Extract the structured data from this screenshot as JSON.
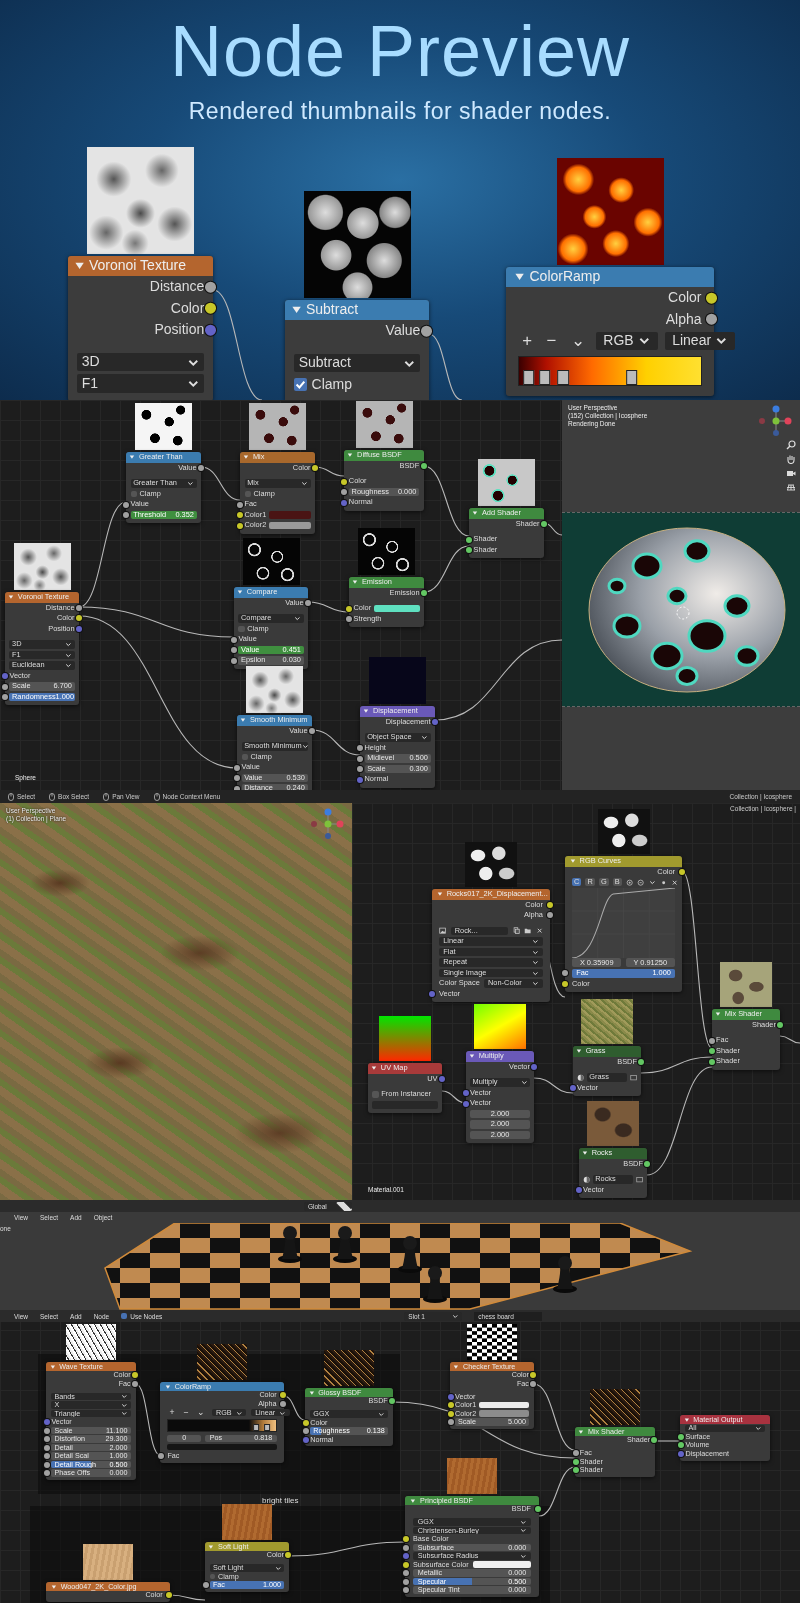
{
  "hero": {
    "title": "Node Preview",
    "subtitle": "Rendered thumbnails for shader nodes.",
    "nodes": [
      {
        "title": "Voronoi Texture",
        "color": "#b4652e",
        "preview": true,
        "rows": [
          {
            "kind": "out",
            "label": "Distance",
            "socket": {
              "color": "#a1a1a1"
            }
          },
          {
            "kind": "out",
            "label": "Color",
            "socket": {
              "color": "#c7c729"
            }
          },
          {
            "kind": "out",
            "label": "Position",
            "socket": {
              "color": "#6363c7"
            }
          },
          {
            "kind": "select",
            "label": "3D"
          },
          {
            "kind": "select",
            "label": "F1"
          }
        ]
      },
      {
        "title": "Subtract",
        "color": "#3b7cb0",
        "preview": true,
        "rows": [
          {
            "kind": "out",
            "label": "Value",
            "socket": {
              "color": "#a1a1a1"
            }
          },
          {
            "kind": "select",
            "label": "Subtract"
          },
          {
            "kind": "check",
            "label": "Clamp",
            "checked": true
          }
        ]
      },
      {
        "title": "ColorRamp",
        "color": "#3b7cb0",
        "preview": true,
        "rows": [
          {
            "kind": "out",
            "label": "Color",
            "socket": {
              "color": "#c7c729"
            }
          },
          {
            "kind": "out",
            "label": "Alpha",
            "socket": {
              "color": "#a1a1a1"
            }
          },
          {
            "kind": "ramp",
            "buttons": [
              "+",
              "−",
              "⌄"
            ],
            "mode": "RGB",
            "interpolation": "Linear"
          }
        ]
      }
    ]
  },
  "sphere_scene": {
    "node_editor": {
      "object_label": "Sphere",
      "nodes": [
        {
          "title": "Greater Than",
          "color": "#3b7cb0",
          "preview": true,
          "rows": [
            {
              "kind": "out",
              "label": "Value",
              "socket": {
                "color": "#a1a1a1"
              }
            },
            {
              "kind": "select",
              "label": "Greater Than"
            },
            {
              "kind": "check",
              "label": "Clamp",
              "checked": false
            },
            {
              "kind": "in",
              "label": "Value",
              "socket": {
                "color": "#a1a1a1"
              }
            },
            {
              "kind": "animated",
              "label": "Threshold",
              "value": "0.352",
              "socket": {
                "color": "#a1a1a1"
              }
            }
          ]
        },
        {
          "title": "Mix",
          "color": "#a8682c",
          "preview": true,
          "rows": [
            {
              "kind": "out",
              "label": "Color",
              "socket": {
                "color": "#c7c729"
              }
            },
            {
              "kind": "select",
              "label": "Mix"
            },
            {
              "kind": "check",
              "label": "Clamp",
              "checked": false
            },
            {
              "kind": "in",
              "label": "Fac",
              "socket": {
                "color": "#a1a1a1"
              }
            },
            {
              "kind": "swatch",
              "label": "Color1",
              "color": "#4a1414",
              "socket": {
                "color": "#c7c729"
              }
            },
            {
              "kind": "swatch",
              "label": "Color2",
              "color": "#9a9a9a",
              "socket": {
                "color": "#c7c729"
              }
            }
          ]
        },
        {
          "title": "Diffuse BSDF",
          "color": "#3f8a3f",
          "preview": true,
          "rows": [
            {
              "kind": "out",
              "label": "BSDF",
              "socket": {
                "color": "#63c763"
              }
            },
            {
              "kind": "in",
              "label": "Color",
              "socket": {
                "color": "#c7c729"
              }
            },
            {
              "kind": "num",
              "label": "Roughness",
              "value": "0.000",
              "socket": {
                "color": "#a1a1a1"
              }
            },
            {
              "kind": "in",
              "label": "Normal",
              "socket": {
                "color": "#6363c7"
              }
            }
          ]
        },
        {
          "title": "Add Shader",
          "color": "#3f8a3f",
          "preview": true,
          "rows": [
            {
              "kind": "out",
              "label": "Shader",
              "socket": {
                "color": "#63c763"
              }
            },
            {
              "kind": "in",
              "label": "Shader",
              "socket": {
                "color": "#63c763"
              }
            },
            {
              "kind": "in",
              "label": "Shader",
              "socket": {
                "color": "#63c763"
              }
            }
          ]
        },
        {
          "title": "Voronoi Texture",
          "color": "#b4652e",
          "preview": true,
          "rows": [
            {
              "kind": "out",
              "label": "Distance",
              "socket": {
                "color": "#a1a1a1"
              }
            },
            {
              "kind": "out",
              "label": "Color",
              "socket": {
                "color": "#c7c729"
              }
            },
            {
              "kind": "out",
              "label": "Position",
              "socket": {
                "color": "#6363c7"
              }
            },
            {
              "kind": "select",
              "label": "3D"
            },
            {
              "kind": "select",
              "label": "F1"
            },
            {
              "kind": "select",
              "label": "Euclidean"
            },
            {
              "kind": "in",
              "label": "Vector",
              "socket": {
                "color": "#6363c7"
              }
            },
            {
              "kind": "num",
              "label": "Scale",
              "value": "6.700",
              "socket": {
                "color": "#a1a1a1"
              }
            },
            {
              "kind": "slider",
              "label": "Randomness",
              "value": "1.000",
              "level": 1,
              "socket": {
                "color": "#a1a1a1"
              }
            }
          ]
        },
        {
          "title": "Compare",
          "color": "#3b7cb0",
          "preview": true,
          "rows": [
            {
              "kind": "out",
              "label": "Value",
              "socket": {
                "color": "#a1a1a1"
              }
            },
            {
              "kind": "select",
              "label": "Compare"
            },
            {
              "kind": "check",
              "label": "Clamp",
              "checked": false
            },
            {
              "kind": "in",
              "label": "Value",
              "socket": {
                "color": "#a1a1a1"
              }
            },
            {
              "kind": "animated",
              "label": "Value",
              "value": "0.451",
              "socket": {
                "color": "#a1a1a1"
              }
            },
            {
              "kind": "num",
              "label": "Epsilon",
              "value": "0.030",
              "socket": {
                "color": "#a1a1a1"
              }
            }
          ]
        },
        {
          "title": "Emission",
          "color": "#3f8a3f",
          "preview": true,
          "rows": [
            {
              "kind": "out",
              "label": "Emission",
              "socket": {
                "color": "#63c763"
              }
            },
            {
              "kind": "swatch",
              "label": "Color",
              "color": "#5fe0c0",
              "socket": {
                "color": "#c7c729"
              }
            },
            {
              "kind": "in",
              "label": "Strength",
              "socket": {
                "color": "#a1a1a1"
              }
            }
          ]
        },
        {
          "title": "Smooth Minimum",
          "color": "#3b7cb0",
          "preview": true,
          "rows": [
            {
              "kind": "out",
              "label": "Value",
              "socket": {
                "color": "#a1a1a1"
              }
            },
            {
              "kind": "select",
              "label": "Smooth Minimum"
            },
            {
              "kind": "check",
              "label": "Clamp",
              "checked": false
            },
            {
              "kind": "in",
              "label": "Value",
              "socket": {
                "color": "#a1a1a1"
              }
            },
            {
              "kind": "num",
              "label": "Value",
              "value": "0.530",
              "socket": {
                "color": "#a1a1a1"
              }
            },
            {
              "kind": "num",
              "label": "Distance",
              "value": "0.240",
              "socket": {
                "color": "#a1a1a1"
              }
            }
          ]
        },
        {
          "title": "Displacement",
          "color": "#6a59b8",
          "preview": true,
          "rows": [
            {
              "kind": "out",
              "label": "Displacement",
              "socket": {
                "color": "#6363c7"
              }
            },
            {
              "kind": "select",
              "label": "Object Space"
            },
            {
              "kind": "in",
              "label": "Height",
              "socket": {
                "color": "#a1a1a1"
              }
            },
            {
              "kind": "num",
              "label": "Midlevel",
              "value": "0.500",
              "socket": {
                "color": "#a1a1a1"
              }
            },
            {
              "kind": "num",
              "label": "Scale",
              "value": "0.300",
              "socket": {
                "color": "#a1a1a1"
              }
            },
            {
              "kind": "in",
              "label": "Normal",
              "socket": {
                "color": "#6363c7"
              }
            }
          ]
        }
      ]
    },
    "viewport": {
      "lines": [
        "User Perspective",
        "(152) Collection | Icosphere",
        "Rendering Done"
      ]
    },
    "status_bar": {
      "items": [
        "Select",
        "Box Select",
        "Pan View",
        "Node Context Menu"
      ],
      "right": "Collection | Icosphere"
    }
  },
  "terrain_scene": {
    "viewport": {
      "lines": [
        "User Perspective",
        "(1) Collection | Plane"
      ]
    },
    "node_editor": {
      "status": "Collection | Icosphere |",
      "material_label": "Material.001",
      "nodes": [
        {
          "title": "Rocks017_2K_Displacement...",
          "color": "#b4652e",
          "preview": true,
          "rows": [
            {
              "kind": "out",
              "label": "Color",
              "socket": {
                "color": "#c7c729"
              }
            },
            {
              "kind": "out",
              "label": "Alpha",
              "socket": {
                "color": "#a1a1a1"
              }
            },
            {
              "kind": "image",
              "name": "Rock..."
            },
            {
              "kind": "select",
              "label": "Linear"
            },
            {
              "kind": "select",
              "label": "Flat"
            },
            {
              "kind": "select",
              "label": "Repeat"
            },
            {
              "kind": "select",
              "label": "Single Image"
            },
            {
              "kind": "labeled-select",
              "label": "Color Space",
              "value": "Non-Color"
            },
            {
              "kind": "in",
              "label": "Vector",
              "socket": {
                "color": "#6363c7"
              }
            }
          ]
        },
        {
          "title": "RGB Curves",
          "color": "#a19a2e",
          "preview": true,
          "rows": [
            {
              "kind": "out",
              "label": "Color",
              "socket": {
                "color": "#c7c729"
              }
            },
            {
              "kind": "curve",
              "channels": [
                {
                  "label": "C",
                  "selected": true
                },
                {
                  "label": "R",
                  "selected": false
                },
                {
                  "label": "G",
                  "selected": false
                },
                {
                  "label": "B",
                  "selected": false
                }
              ],
              "x": "X 0.35909",
              "y": "Y 0.91250"
            },
            {
              "kind": "slider",
              "label": "Fac",
              "value": "1.000",
              "level": 1,
              "socket": {
                "color": "#a1a1a1"
              }
            },
            {
              "kind": "in",
              "label": "Color",
              "socket": {
                "color": "#c7c729"
              }
            }
          ]
        },
        {
          "title": "UV Map",
          "color": "#a83a3a",
          "preview": true,
          "rows": [
            {
              "kind": "out",
              "label": "UV",
              "socket": {
                "color": "#6363c7"
              }
            },
            {
              "kind": "check",
              "label": "From Instancer",
              "checked": false
            },
            {
              "kind": "blank"
            }
          ]
        },
        {
          "title": "Multiply",
          "color": "#6a59b8",
          "preview": true,
          "rows": [
            {
              "kind": "out",
              "label": "Vector",
              "socket": {
                "color": "#6363c7"
              }
            },
            {
              "kind": "select",
              "label": "Multiply"
            },
            {
              "kind": "in",
              "label": "Vector",
              "socket": {
                "color": "#6363c7"
              }
            },
            {
              "kind": "in",
              "label": "Vector",
              "socket": {
                "color": "#6363c7"
              }
            },
            {
              "kind": "value",
              "value": "2.000"
            },
            {
              "kind": "value",
              "value": "2.000"
            },
            {
              "kind": "value",
              "value": "2.000"
            }
          ]
        },
        {
          "title": "Grass",
          "color": "#2f5d2f",
          "preview": true,
          "rows": [
            {
              "kind": "out",
              "label": "BSDF",
              "socket": {
                "color": "#63c763"
              }
            },
            {
              "kind": "material",
              "name": "Grass"
            },
            {
              "kind": "in",
              "label": "Vector",
              "socket": {
                "color": "#6363c7"
              }
            }
          ]
        },
        {
          "title": "Mix Shader",
          "color": "#3f8a3f",
          "preview": true,
          "rows": [
            {
              "kind": "out",
              "label": "Shader",
              "socket": {
                "color": "#63c763"
              }
            },
            {
              "kind": "in",
              "label": "Fac",
              "socket": {
                "color": "#a1a1a1"
              }
            },
            {
              "kind": "in",
              "label": "Shader",
              "socket": {
                "color": "#63c763"
              }
            },
            {
              "kind": "in",
              "label": "Shader",
              "socket": {
                "color": "#63c763"
              }
            }
          ]
        },
        {
          "title": "Rocks",
          "color": "#2f5d2f",
          "preview": true,
          "rows": [
            {
              "kind": "out",
              "label": "BSDF",
              "socket": {
                "color": "#63c763"
              }
            },
            {
              "kind": "material",
              "name": "Rocks"
            },
            {
              "kind": "in",
              "label": "Vector",
              "socket": {
                "color": "#6363c7"
              }
            }
          ]
        }
      ]
    }
  },
  "chess_scene": {
    "viewport": {
      "orientation": "Global",
      "menu": [
        "View",
        "Select",
        "Add",
        "Object"
      ],
      "side_text": "one"
    },
    "node_editor": {
      "menu": [
        "View",
        "Select",
        "Add",
        "Node"
      ],
      "use_nodes": {
        "label": "Use Nodes",
        "checked": true
      },
      "slot": "Slot 1",
      "material": "chess board",
      "frame_label": "bright tiles",
      "nodes": [
        {
          "title": "Wave Texture",
          "color": "#b4652e",
          "preview": true,
          "rows": [
            {
              "kind": "out",
              "label": "Color",
              "socket": {
                "color": "#c7c729"
              }
            },
            {
              "kind": "out",
              "label": "Fac",
              "socket": {
                "color": "#a1a1a1"
              }
            },
            {
              "kind": "select",
              "label": "Bands"
            },
            {
              "kind": "select",
              "label": "X"
            },
            {
              "kind": "select",
              "label": "Triangle"
            },
            {
              "kind": "in",
              "label": "Vector",
              "socket": {
                "color": "#6363c7"
              }
            },
            {
              "kind": "num",
              "label": "Scale",
              "value": "11.100",
              "socket": {
                "color": "#a1a1a1"
              }
            },
            {
              "kind": "num",
              "label": "Distortion",
              "value": "29.300",
              "socket": {
                "color": "#a1a1a1"
              }
            },
            {
              "kind": "num",
              "label": "Detail",
              "value": "2.000",
              "socket": {
                "color": "#a1a1a1"
              }
            },
            {
              "kind": "num",
              "label": "Detail Scal",
              "value": "1.000",
              "socket": {
                "color": "#a1a1a1"
              }
            },
            {
              "kind": "slider",
              "label": "Detail Rough",
              "value": "0.500",
              "level": 0.5,
              "socket": {
                "color": "#a1a1a1"
              }
            },
            {
              "kind": "num",
              "label": "Phase Offs",
              "value": "0.000",
              "socket": {
                "color": "#a1a1a1"
              }
            }
          ]
        },
        {
          "title": "ColorRamp",
          "color": "#3b7cb0",
          "preview": true,
          "rows": [
            {
              "kind": "out",
              "label": "Color",
              "socket": {
                "color": "#c7c729"
              }
            },
            {
              "kind": "out",
              "label": "Alpha",
              "socket": {
                "color": "#a1a1a1"
              }
            },
            {
              "kind": "ramp",
              "buttons": [
                "+",
                "−",
                "⌄"
              ],
              "mode": "RGB",
              "interpolation": "Linear"
            },
            {
              "kind": "stop",
              "index": "0",
              "label": "Pos",
              "value": "0.818"
            },
            {
              "kind": "colorbar"
            },
            {
              "kind": "in",
              "label": "Fac",
              "socket": {
                "color": "#a1a1a1"
              }
            }
          ]
        },
        {
          "title": "Glossy BSDF",
          "color": "#3f8a3f",
          "preview": true,
          "rows": [
            {
              "kind": "out",
              "label": "BSDF",
              "socket": {
                "color": "#63c763"
              }
            },
            {
              "kind": "select",
              "label": "GGX"
            },
            {
              "kind": "in",
              "label": "Color",
              "socket": {
                "color": "#c7c729"
              }
            },
            {
              "kind": "slider",
              "label": "Roughness",
              "value": "0.138",
              "level": 0.138,
              "socket": {
                "color": "#a1a1a1"
              }
            },
            {
              "kind": "in",
              "label": "Normal",
              "socket": {
                "color": "#6363c7"
              }
            }
          ]
        },
        {
          "title": "Checker Texture",
          "color": "#b4652e",
          "preview": true,
          "rows": [
            {
              "kind": "out",
              "label": "Color",
              "socket": {
                "color": "#c7c729"
              }
            },
            {
              "kind": "out",
              "label": "Fac",
              "socket": {
                "color": "#a1a1a1"
              }
            },
            {
              "kind": "in",
              "label": "Vector",
              "socket": {
                "color": "#6363c7"
              }
            },
            {
              "kind": "swatch",
              "label": "Color1",
              "color": "#ececec",
              "socket": {
                "color": "#c7c729"
              }
            },
            {
              "kind": "swatch",
              "label": "Color2",
              "color": "#8c8c8c",
              "socket": {
                "color": "#c7c729"
              }
            },
            {
              "kind": "num",
              "label": "Scale",
              "value": "5.000",
              "socket": {
                "color": "#a1a1a1"
              }
            }
          ]
        },
        {
          "title": "Mix Shader",
          "color": "#3f8a3f",
          "preview": true,
          "rows": [
            {
              "kind": "out",
              "label": "Shader",
              "socket": {
                "color": "#63c763"
              }
            },
            {
              "kind": "in",
              "label": "Fac",
              "socket": {
                "color": "#a1a1a1"
              }
            },
            {
              "kind": "in",
              "label": "Shader",
              "socket": {
                "color": "#63c763"
              }
            },
            {
              "kind": "in",
              "label": "Shader",
              "socket": {
                "color": "#63c763"
              }
            }
          ]
        },
        {
          "title": "Material Output",
          "color": "#a8323f",
          "preview": false,
          "rows": [
            {
              "kind": "select",
              "label": "All"
            },
            {
              "kind": "in",
              "label": "Surface",
              "socket": {
                "color": "#63c763"
              }
            },
            {
              "kind": "in",
              "label": "Volume",
              "socket": {
                "color": "#63c763"
              }
            },
            {
              "kind": "in",
              "label": "Displacement",
              "socket": {
                "color": "#6363c7"
              }
            }
          ]
        },
        {
          "title": "Wood047_2K_Color.jpg",
          "color": "#b4652e",
          "preview": true,
          "rows": [
            {
              "kind": "out",
              "label": "Color",
              "socket": {
                "color": "#c7c729"
              }
            }
          ]
        },
        {
          "title": "Soft Light",
          "color": "#a19a2e",
          "preview": true,
          "rows": [
            {
              "kind": "out",
              "label": "Color",
              "socket": {
                "color": "#c7c729"
              }
            },
            {
              "kind": "select",
              "label": "Soft Light"
            },
            {
              "kind": "check",
              "label": "Clamp",
              "checked": false
            },
            {
              "kind": "slider",
              "label": "Fac",
              "value": "1.000",
              "level": 1,
              "socket": {
                "color": "#a1a1a1"
              }
            }
          ]
        },
        {
          "title": "Principled BSDF",
          "color": "#3f8a3f",
          "preview": true,
          "rows": [
            {
              "kind": "out",
              "label": "BSDF",
              "socket": {
                "color": "#63c763"
              }
            },
            {
              "kind": "select",
              "label": "GGX"
            },
            {
              "kind": "select",
              "label": "Christensen-Burley"
            },
            {
              "kind": "in",
              "label": "Base Color",
              "socket": {
                "color": "#c7c729"
              }
            },
            {
              "kind": "num",
              "label": "Subsurface",
              "value": "0.000",
              "socket": {
                "color": "#a1a1a1"
              }
            },
            {
              "kind": "select",
              "label": "Subsurface Radius",
              "socket": {
                "color": "#6363c7"
              }
            },
            {
              "kind": "swatch",
              "label": "Subsurface Color",
              "color": "#f0f0f0",
              "socket": {
                "color": "#c7c729"
              }
            },
            {
              "kind": "num",
              "label": "Metallic",
              "value": "0.000",
              "socket": {
                "color": "#a1a1a1"
              }
            },
            {
              "kind": "slider",
              "label": "Specular",
              "value": "0.500",
              "level": 0.5,
              "socket": {
                "color": "#a1a1a1"
              }
            },
            {
              "kind": "num",
              "label": "Specular Tint",
              "value": "0.000",
              "socket": {
                "color": "#a1a1a1"
              }
            }
          ]
        }
      ]
    }
  }
}
